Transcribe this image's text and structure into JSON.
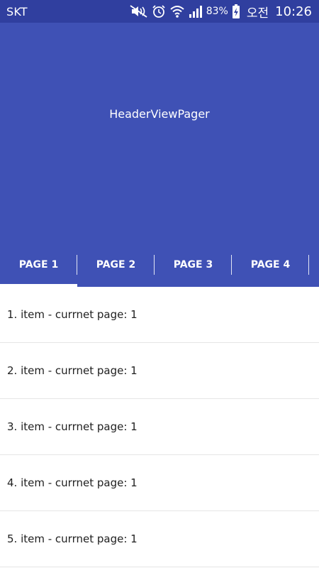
{
  "status_bar": {
    "carrier": "SKT",
    "battery_percent": "83%",
    "ampm": "오전",
    "time": "10:26"
  },
  "header": {
    "title": "HeaderViewPager"
  },
  "tabs": [
    {
      "label": "PAGE 1",
      "selected": true
    },
    {
      "label": "PAGE 2",
      "selected": false
    },
    {
      "label": "PAGE 3",
      "selected": false
    },
    {
      "label": "PAGE 4",
      "selected": false
    }
  ],
  "list": {
    "items": [
      "1. item - currnet page: 1",
      "2. item - currnet page: 1",
      "3. item - currnet page: 1",
      "4. item - currnet page: 1",
      "5. item - currnet page: 1"
    ]
  },
  "colors": {
    "status_bar": "#303f9f",
    "primary": "#3f51b5",
    "tab_indicator": "#ffffff",
    "text": "#212121"
  }
}
